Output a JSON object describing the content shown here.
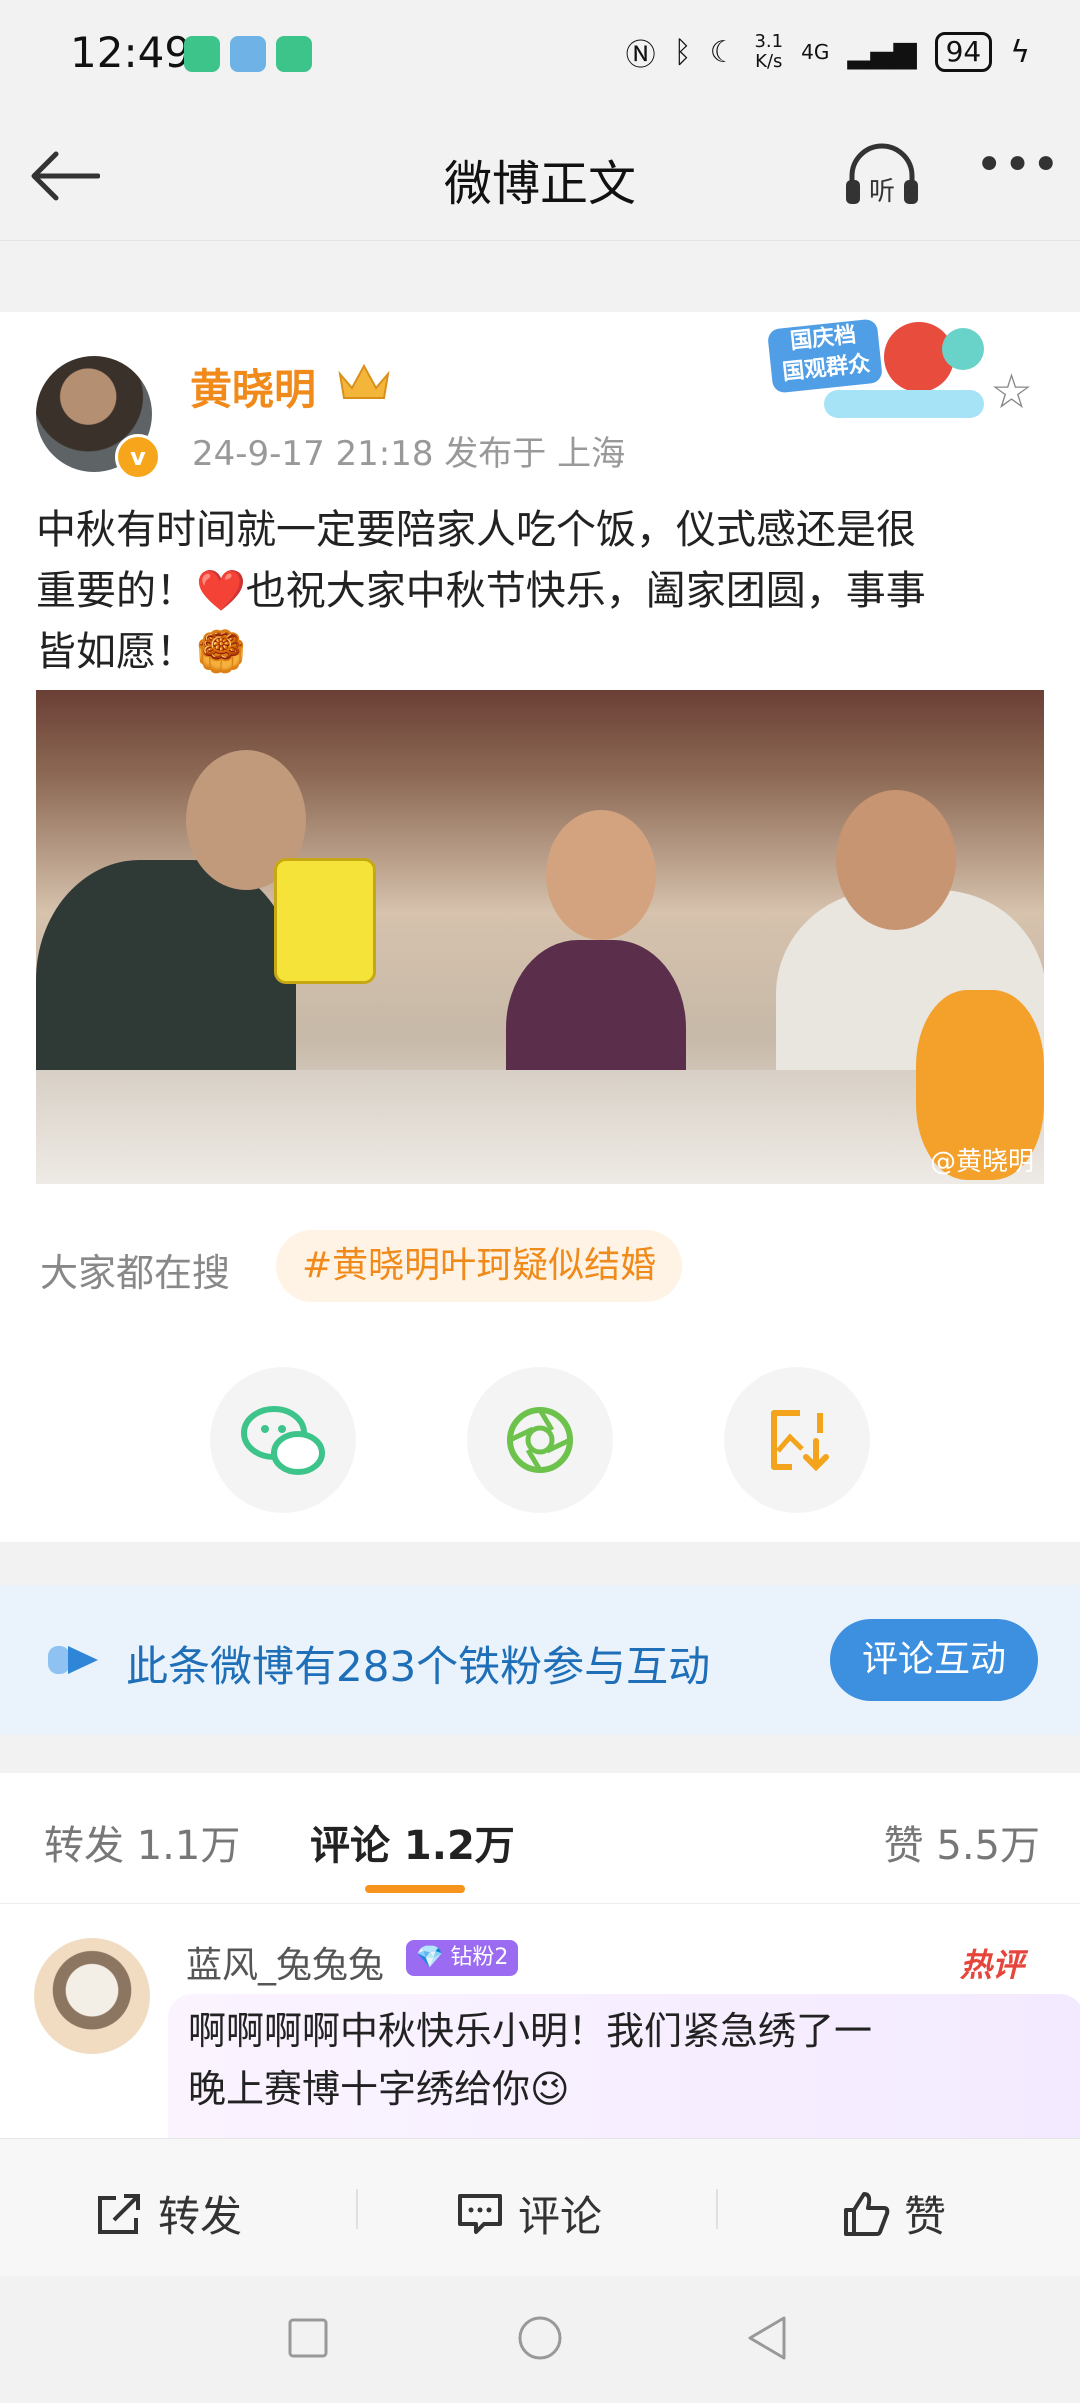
{
  "status_bar": {
    "time": "12:49",
    "net_speed_top": "3.1",
    "net_speed_bottom": "K/s",
    "network": "4G",
    "battery": "94"
  },
  "header": {
    "title": "微博正文",
    "listen_label": "听"
  },
  "post": {
    "author": "黄晓明",
    "avatar_badge": "v",
    "meta": "24-9-17 21:18  发布于 上海",
    "promo_text_1": "国庆档",
    "promo_text_2": "国观群众",
    "text_line1": "中秋有时间就一定要陪家人吃个饭，仪式感还是很",
    "text_line2": "重要的！❤️也祝大家中秋节快乐，阖家团圆，事事",
    "text_line3": "皆如愿！🥮",
    "watermark": "@黄晓明",
    "search_label": "大家都在搜",
    "hot_tag": "#黄晓明叶珂疑似结婚"
  },
  "fans_banner": {
    "text": "此条微博有283个铁粉参与互动",
    "button": "评论互动"
  },
  "tabs": {
    "repost": "转发 1.1万",
    "comment": "评论 1.2万",
    "like": "赞 5.5万"
  },
  "comment": {
    "user": "蓝风_兔兔兔",
    "badge": "钻粉2",
    "hot_label": "热评",
    "line1": "啊啊啊啊中秋快乐小明！我们紧急绣了一",
    "line2": "晚上赛博十字绣给你😉"
  },
  "action_bar": {
    "repost": "转发",
    "comment": "评论",
    "like": "赞"
  },
  "colors": {
    "accent_orange": "#f08a1a",
    "link_blue": "#1f6fb8",
    "button_blue": "#3d8fe0",
    "vip_purple": "#9b6bf2"
  },
  "icons": [
    "back-arrow-icon",
    "headphones-icon",
    "more-icon",
    "crown-icon",
    "star-icon",
    "wechat-icon",
    "moments-icon",
    "save-image-icon",
    "repost-icon",
    "comment-icon",
    "like-icon"
  ]
}
